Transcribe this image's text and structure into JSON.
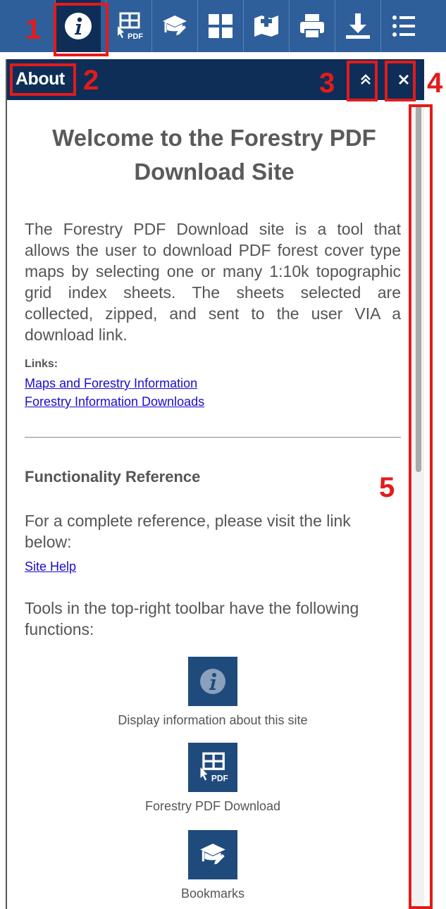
{
  "toolbar": {
    "items": [
      {
        "name": "about-info-icon"
      },
      {
        "name": "forestry-pdf-download-icon"
      },
      {
        "name": "bookmarks-icon"
      },
      {
        "name": "basemap-gallery-icon"
      },
      {
        "name": "add-data-icon"
      },
      {
        "name": "print-icon"
      },
      {
        "name": "download-icon"
      },
      {
        "name": "layer-list-icon"
      }
    ]
  },
  "callouts": {
    "c1": "1",
    "c2": "2",
    "c3": "3",
    "c4": "4",
    "c5": "5"
  },
  "panel": {
    "title": "About",
    "heading": "Welcome to the Forestry PDF Download Site",
    "intro": "The Forestry PDF Download site is a tool that allows the user to download PDF forest cover type maps by selecting one or many 1:10k topographic grid index sheets. The sheets selected are collected, zipped, and sent to the user VIA a download link.",
    "links_label": "Links:",
    "link1": "Maps and Forestry Information",
    "link2": "Forestry Information Downloads",
    "func_heading": "Functionality Reference",
    "func_para": "For a complete reference, please visit the link below:",
    "site_help": "Site Help",
    "tools_para": "Tools in the top-right toolbar have the following functions:",
    "tools": [
      {
        "icon": "info-icon",
        "caption": "Display information about this site"
      },
      {
        "icon": "forestry-pdf-icon",
        "caption": "Forestry PDF Download"
      },
      {
        "icon": "bookmarks-icon",
        "caption": "Bookmarks"
      }
    ]
  },
  "colors": {
    "toolbar": "#2f5f9a",
    "header": "#0e2e58",
    "callout": "#e31b1b",
    "link": "#1a0dcc"
  }
}
